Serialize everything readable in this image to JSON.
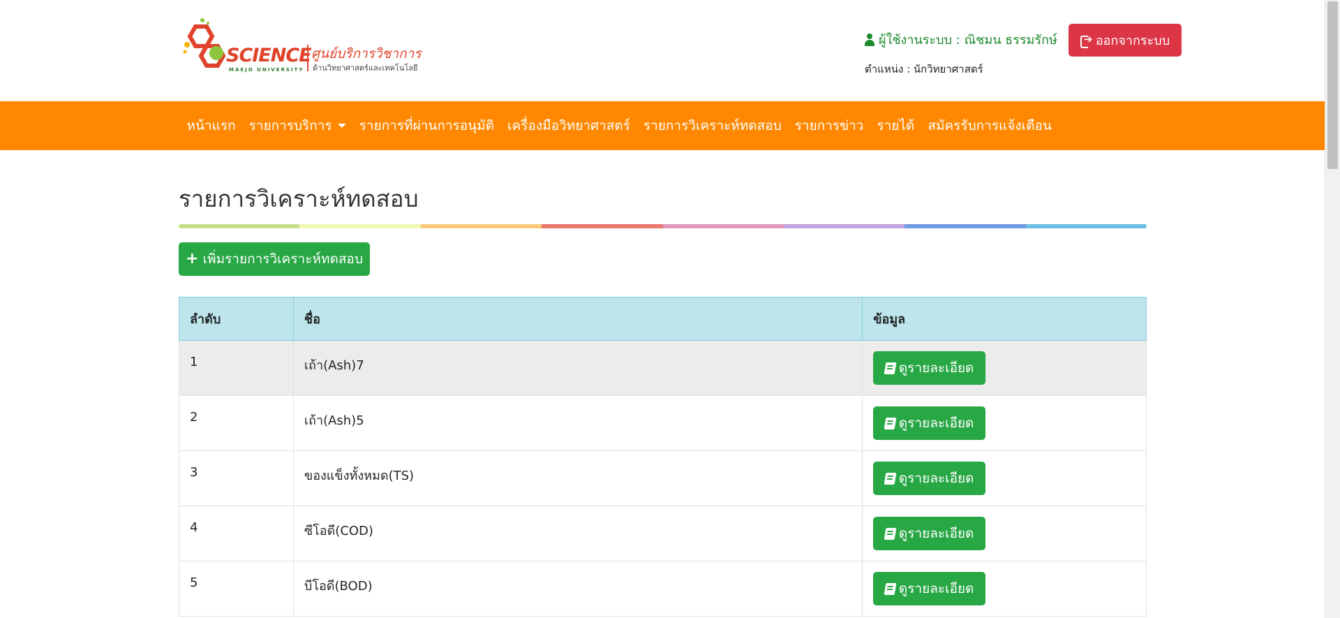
{
  "logo": {
    "word": "SCIENCE",
    "subtitle_en": "MAEJO UNIVERSITY",
    "title_th": "ศูนย์บริการวิชาการ",
    "subtitle_th": "ด้านวิทยาศาสตร์และเทคโนโลยี"
  },
  "user": {
    "label": "ผู้ใช้งานระบบ : ณิชมน ธรรมรักษ์",
    "position": "ตำแหน่ง : นักวิทยาศาสตร์"
  },
  "logout_label": "ออกจากระบบ",
  "nav": {
    "items": [
      {
        "label": "หน้าแรก"
      },
      {
        "label": "รายการบริการ"
      },
      {
        "label": "รายการที่ผ่านการอนุมัติ"
      },
      {
        "label": "เครื่องมือวิทยาศาสตร์"
      },
      {
        "label": "รายการวิเคราะห์ทดสอบ"
      },
      {
        "label": "รายการข่าว"
      },
      {
        "label": "รายได้"
      },
      {
        "label": "สมัครรับการแจ้งเตือน"
      }
    ]
  },
  "page_title": "รายการวิเคราะห์ทดสอบ",
  "add_button_label": "เพิ่มรายการวิเคราะห์ทดสอบ",
  "table": {
    "headers": [
      "ลำดับ",
      "ชื่อ",
      "ข้อมูล"
    ],
    "rows": [
      {
        "no": "1",
        "name": "เถ้า(Ash)7",
        "action": "ดูรายละเอียด"
      },
      {
        "no": "2",
        "name": "เถ้า(Ash)5",
        "action": "ดูรายละเอียด"
      },
      {
        "no": "3",
        "name": "ของแข็งทั้งหมด(TS)",
        "action": "ดูรายละเอียด"
      },
      {
        "no": "4",
        "name": "ซีโอดี(COD)",
        "action": "ดูรายละเอียด"
      },
      {
        "no": "5",
        "name": "บีโอดี(BOD)",
        "action": "ดูรายละเอียด"
      }
    ]
  },
  "colors": {
    "navbar": "#ff8800",
    "danger": "#dc3545",
    "success": "#28a745",
    "table_header": "#bee5eb",
    "user_text": "#1d8a2c",
    "rainbow": [
      "#c5de8c",
      "#f0f7b4",
      "#f9c97a",
      "#e9776c",
      "#e09ab9",
      "#c4a2e0",
      "#6f9be0",
      "#6cbfe5"
    ]
  }
}
